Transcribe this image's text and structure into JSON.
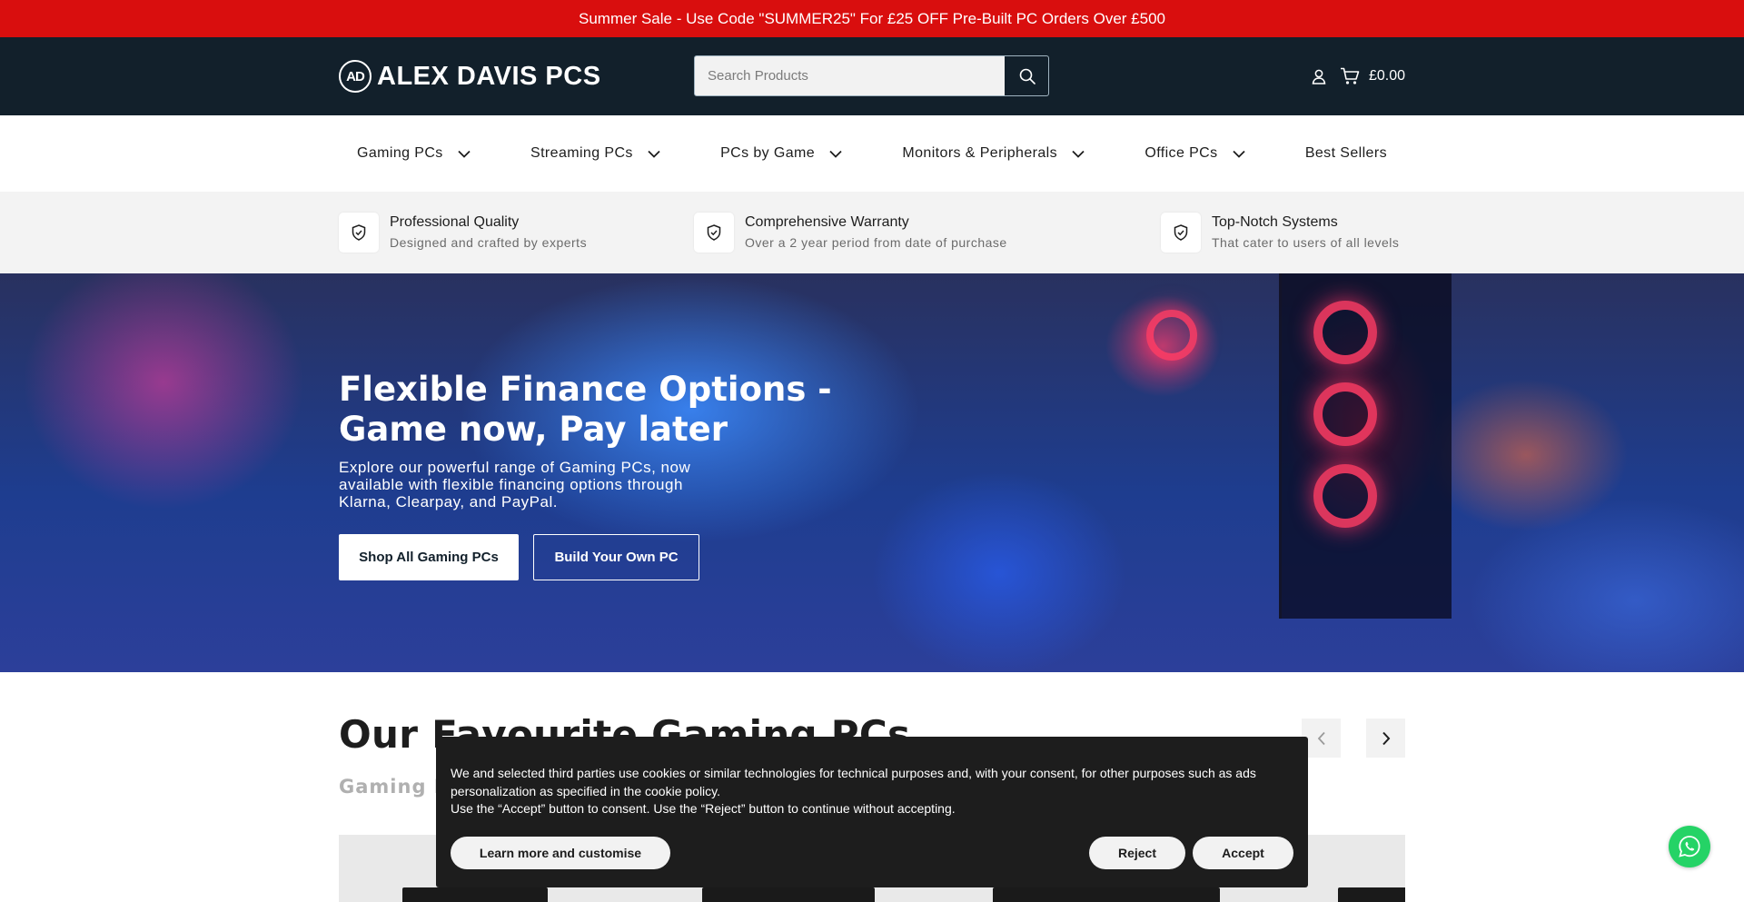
{
  "promo": {
    "text": "Summer Sale - Use Code \"SUMMER25\" For £25 OFF Pre-Built PC Orders Over £500"
  },
  "header": {
    "logo_mark": "AD",
    "logo_text": "ALEX DAVIS PCS",
    "search_placeholder": "Search Products",
    "cart_total": "£0.00",
    "icons": [
      "search-icon",
      "account-icon",
      "cart-icon"
    ]
  },
  "nav": {
    "items": [
      {
        "label": "Gaming PCs",
        "has_dropdown": true
      },
      {
        "label": "Streaming PCs",
        "has_dropdown": true
      },
      {
        "label": "PCs by Game",
        "has_dropdown": true
      },
      {
        "label": "Monitors & Peripherals",
        "has_dropdown": true
      },
      {
        "label": "Office PCs",
        "has_dropdown": true
      },
      {
        "label": "Best Sellers",
        "has_dropdown": false
      }
    ]
  },
  "usp": [
    {
      "title": "Professional Quality",
      "subtitle": "Designed and crafted by experts",
      "icon": "shield-check-icon"
    },
    {
      "title": "Comprehensive Warranty",
      "subtitle": "Over a 2 year period from date of purchase",
      "icon": "shield-check-icon"
    },
    {
      "title": "Top-Notch Systems",
      "subtitle": "That cater to users of all levels",
      "icon": "shield-check-icon"
    }
  ],
  "hero": {
    "title": "Flexible Finance Options - Game now, Pay later",
    "text": "Explore our powerful range of Gaming PCs, now available with flexible financing options through Klarna, Clearpay, and PayPal.",
    "primary_button": "Shop All Gaming PCs",
    "secondary_button": "Build Your Own PC"
  },
  "favourites": {
    "title": "Our Favourite Gaming PCs",
    "subtitle": "Gaming P"
  },
  "cookie": {
    "line1": "We and selected third parties use cookies or similar technologies for technical purposes and, with your consent, for other purposes such as ads personalization as specified in the cookie policy.",
    "line2": "Use the “Accept” button to consent. Use the “Reject” button to continue without accepting.",
    "learn_more": "Learn more and customise",
    "reject": "Reject",
    "accept": "Accept"
  },
  "colors": {
    "promo_bg": "#d90e0e",
    "header_bg": "#12202b",
    "usp_bg": "#f3f3f3",
    "cookie_bg": "#1d1d1d",
    "whatsapp": "#25d366"
  }
}
